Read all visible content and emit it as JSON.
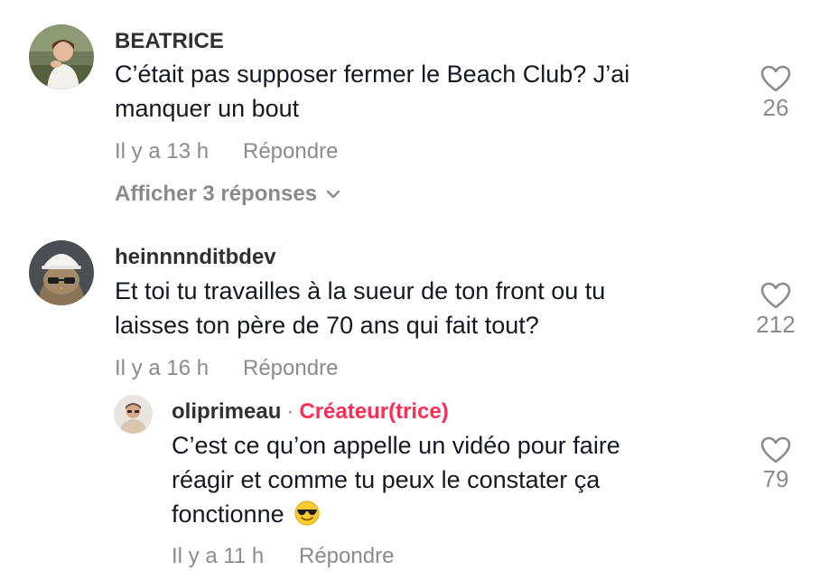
{
  "comments": [
    {
      "username": "BEATRICE",
      "text_lines": [
        "C’était pas supposer fermer le Beach Club? J’ai",
        "manquer un bout"
      ],
      "time": "Il y a 13 h",
      "reply_label": "Répondre",
      "likes": "26",
      "view_replies_label": "Afficher 3 réponses"
    },
    {
      "username": "heinnnnditbdev",
      "text_lines": [
        "Et toi tu travailles à la sueur de ton front ou tu",
        "laisses ton père de 70 ans qui fait tout?"
      ],
      "time": "Il y a 16 h",
      "reply_label": "Répondre",
      "likes": "212",
      "replies": [
        {
          "username": "oliprimeau",
          "separator": "·",
          "badge": "Créateur(trice)",
          "text_lines": [
            "C’est ce qu’on appelle un vidéo pour faire",
            "réagir et comme tu peux le constater ça",
            "fonctionne"
          ],
          "emoji": "sunglasses-emoji",
          "time": "Il y a 11 h",
          "reply_label": "Répondre",
          "likes": "79"
        }
      ]
    }
  ],
  "icons": {
    "like": "heart-outline-icon",
    "expand": "chevron-down-icon"
  },
  "colors": {
    "creator_badge": "#fe2c55",
    "muted": "#8a8b91",
    "text": "#161823"
  }
}
